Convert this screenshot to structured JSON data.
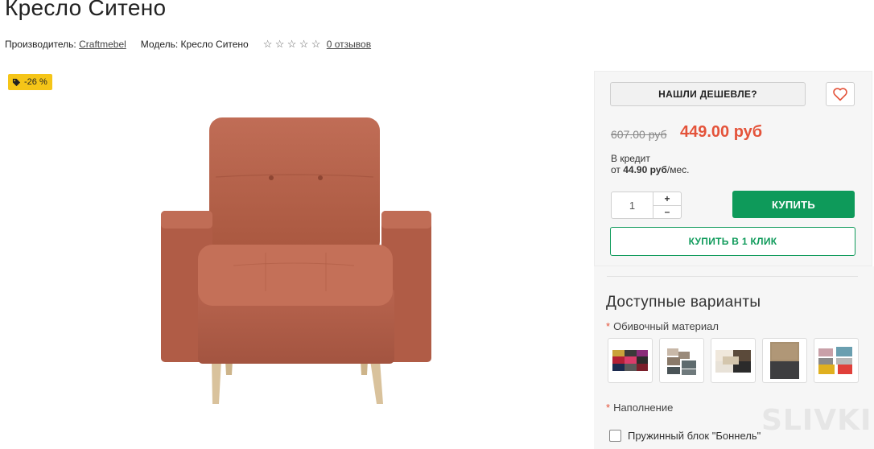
{
  "product": {
    "title": "Кресло Ситено",
    "manufacturer_label": "Производитель:",
    "manufacturer": "Craftmebel",
    "model_label": "Модель:",
    "model": "Кресло Ситено",
    "rating": 0,
    "rating_max": 5,
    "reviews": "0 отзывов"
  },
  "badge": {
    "discount": "-26 %",
    "icon": "tag-icon",
    "color": "#f5c518"
  },
  "purchase": {
    "cheaper_button": "НАШЛИ ДЕШЕВЛЕ?",
    "favorite_icon": "heart-icon",
    "old_price": "607.00 руб",
    "new_price": "449.00 руб",
    "credit_line1": "В кредит",
    "credit_from": "от",
    "credit_amount": "44.90 руб",
    "credit_suffix": "/мес.",
    "quantity": "1",
    "qty_plus": "+",
    "qty_minus": "–",
    "buy_button": "КУПИТЬ",
    "one_click_button": "КУПИТЬ В 1 КЛИК",
    "accent_color": "#0e9a5a",
    "price_color": "#e4533a"
  },
  "variants": {
    "title": "Доступные варианты",
    "upholstery_label": "Обивочный материал",
    "filling_label": "Наполнение",
    "filling_option": "Пружинный блок \"Боннель\"",
    "required_mark": "*"
  },
  "watermark": "SLIVKI"
}
